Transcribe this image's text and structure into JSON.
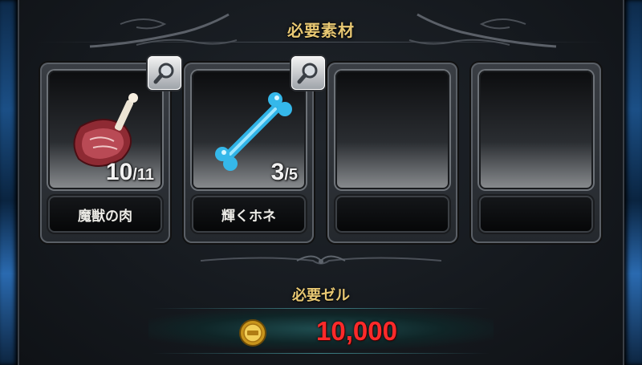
{
  "header": {
    "title": "必要素材"
  },
  "materials": [
    {
      "name": "魔獣の肉",
      "have": "10",
      "sep": "/",
      "need": "11",
      "icon": "meat-icon"
    },
    {
      "name": "輝くホネ",
      "have": "3",
      "sep": "/",
      "need": "5",
      "icon": "bone-icon"
    },
    {
      "name": "",
      "empty": true
    },
    {
      "name": "",
      "empty": true
    }
  ],
  "cost": {
    "title": "必要ゼル",
    "value": "10,000",
    "icon": "gold-coin-icon",
    "color": "#ff2a2a"
  },
  "colors": {
    "title": "#e8c873",
    "accent_blue": "#2a6ab0"
  }
}
